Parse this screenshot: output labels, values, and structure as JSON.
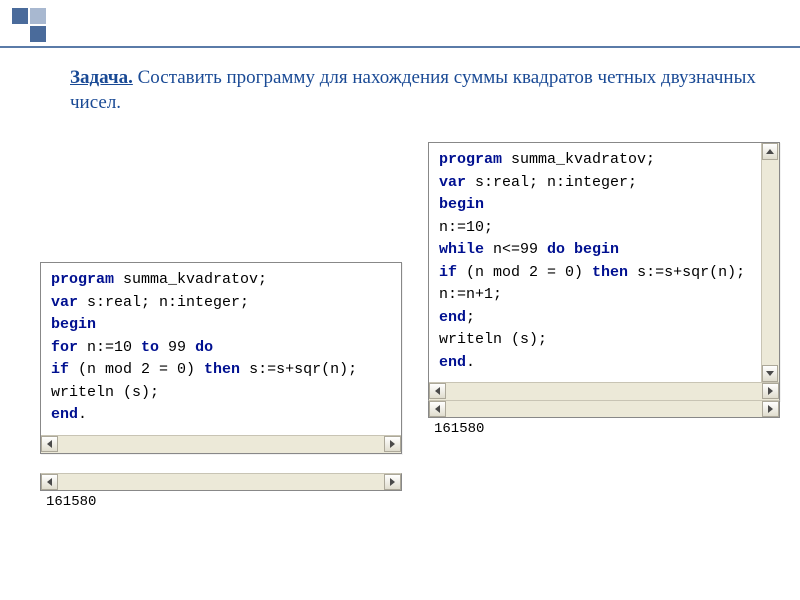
{
  "task": {
    "label": "Задача.",
    "text": "Составить программу для нахождения суммы квадратов четных двузначных чисел."
  },
  "code_left": {
    "lines": [
      {
        "t": "kw",
        "s": "program"
      },
      {
        "t": "p",
        "s": " summa_kvadratov;"
      },
      null,
      {
        "t": "kw",
        "s": "var"
      },
      {
        "t": "p",
        "s": " s:real; n:integer;"
      },
      null,
      {
        "t": "kw",
        "s": "begin"
      },
      null,
      {
        "t": "kw",
        "s": "for"
      },
      {
        "t": "p",
        "s": " n:=10 "
      },
      {
        "t": "kw",
        "s": "to"
      },
      {
        "t": "p",
        "s": " 99 "
      },
      {
        "t": "kw",
        "s": "do"
      },
      null,
      {
        "t": "kw",
        "s": "if"
      },
      {
        "t": "p",
        "s": " (n mod 2 = 0) "
      },
      {
        "t": "kw",
        "s": "then"
      },
      {
        "t": "p",
        "s": " s:=s+sqr(n);"
      },
      null,
      {
        "t": "p",
        "s": "writeln (s);"
      },
      null,
      {
        "t": "kw",
        "s": "end"
      },
      {
        "t": "p",
        "s": "."
      }
    ]
  },
  "code_right": {
    "lines": [
      {
        "t": "kw",
        "s": "program"
      },
      {
        "t": "p",
        "s": " summa_kvadratov;"
      },
      null,
      {
        "t": "kw",
        "s": "var"
      },
      {
        "t": "p",
        "s": " s:real; n:integer;"
      },
      null,
      {
        "t": "kw",
        "s": "begin"
      },
      null,
      {
        "t": "p",
        "s": "n:=10;"
      },
      null,
      {
        "t": "kw",
        "s": "while"
      },
      {
        "t": "p",
        "s": " n<=99 "
      },
      {
        "t": "kw",
        "s": "do begin"
      },
      null,
      {
        "t": "kw",
        "s": "if"
      },
      {
        "t": "p",
        "s": " (n mod 2 = 0) "
      },
      {
        "t": "kw",
        "s": "then"
      },
      {
        "t": "p",
        "s": " s:=s+sqr(n);"
      },
      null,
      {
        "t": "p",
        "s": "n:=n+1;"
      },
      null,
      {
        "t": "kw",
        "s": "end"
      },
      {
        "t": "p",
        "s": ";"
      },
      null,
      {
        "t": "p",
        "s": "writeln (s);"
      },
      null,
      {
        "t": "kw",
        "s": "end"
      },
      {
        "t": "p",
        "s": "."
      }
    ]
  },
  "output_left": "161580",
  "output_right": "161580"
}
